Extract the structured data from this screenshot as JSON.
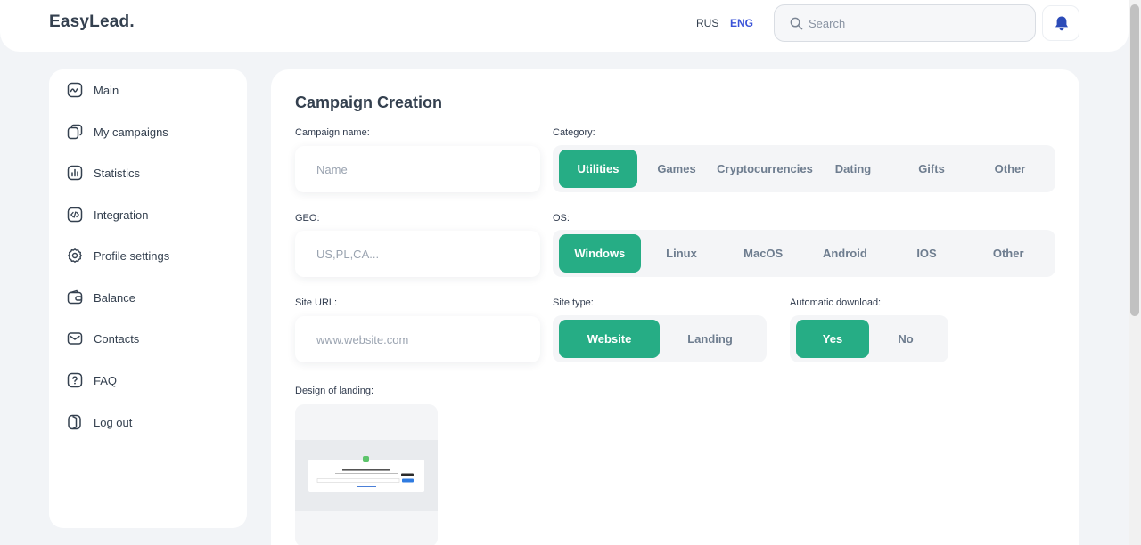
{
  "header": {
    "logo": "EasyLead.",
    "lang_rus": "RUS",
    "lang_eng": "ENG",
    "search_placeholder": "Search"
  },
  "sidebar": {
    "items": [
      {
        "label": "Main",
        "icon": "chart-line-icon"
      },
      {
        "label": "My campaigns",
        "icon": "copy-icon"
      },
      {
        "label": "Statistics",
        "icon": "bar-chart-icon"
      },
      {
        "label": "Integration",
        "icon": "code-icon"
      },
      {
        "label": "Profile settings",
        "icon": "gear-icon"
      },
      {
        "label": "Balance",
        "icon": "wallet-icon"
      },
      {
        "label": "Contacts",
        "icon": "mail-icon"
      },
      {
        "label": "FAQ",
        "icon": "question-icon"
      },
      {
        "label": "Log out",
        "icon": "logout-icon"
      }
    ]
  },
  "form": {
    "title": "Campaign Creation",
    "campaign_name": {
      "label": "Campaign name:",
      "placeholder": "Name",
      "value": ""
    },
    "geo": {
      "label": "GEO:",
      "placeholder": "US,PL,CA...",
      "value": ""
    },
    "site_url": {
      "label": "Site URL:",
      "placeholder": "www.website.com",
      "value": ""
    },
    "category": {
      "label": "Category:",
      "options": [
        "Utilities",
        "Games",
        "Cryptocurrencies",
        "Dating",
        "Gifts",
        "Other"
      ],
      "selected": "Utilities"
    },
    "os": {
      "label": "OS:",
      "options": [
        "Windows",
        "Linux",
        "MacOS",
        "Android",
        "IOS",
        "Other"
      ],
      "selected": "Windows"
    },
    "site_type": {
      "label": "Site type:",
      "options": [
        "Website",
        "Landing"
      ],
      "selected": "Website"
    },
    "auto_download": {
      "label": "Automatic download:",
      "options": [
        "Yes",
        "No"
      ],
      "selected": "Yes"
    },
    "design_label": "Design of landing:"
  },
  "colors": {
    "accent": "#26ad85",
    "active_lang": "#3a53d8",
    "text": "#34404f"
  }
}
